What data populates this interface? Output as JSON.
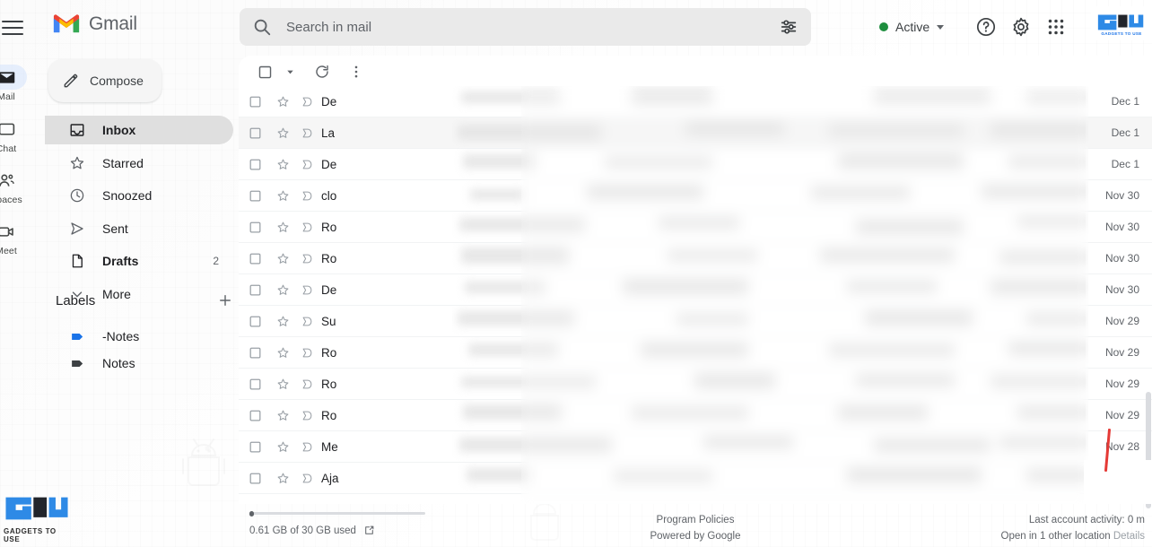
{
  "app": {
    "name": "Gmail",
    "brand_logo": "gmail-m-logo"
  },
  "rail": {
    "menu_icon": "hamburger-menu-icon",
    "items": [
      {
        "label": "Mail",
        "icon": "mail-icon",
        "active": true
      },
      {
        "label": "Chat",
        "icon": "chat-bubble-icon",
        "active": false
      },
      {
        "label": "Spaces",
        "icon": "spaces-people-icon",
        "active": false
      },
      {
        "label": "Meet",
        "icon": "meet-video-icon",
        "active": false
      }
    ]
  },
  "search": {
    "placeholder": "Search in mail",
    "value": "",
    "search_icon": "search-icon",
    "filter_icon": "filter-options-icon"
  },
  "header": {
    "status_label": "Active",
    "status_color": "#1e8e3e",
    "help_icon": "help-question-icon",
    "settings_icon": "gear-settings-icon",
    "apps_icon": "apps-grid-icon",
    "logo_text": "GADGETS TO USE",
    "logo_accent": "#1a73e8"
  },
  "sidebar": {
    "compose_label": "Compose",
    "compose_icon": "pencil-compose-icon",
    "nav": [
      {
        "label": "Inbox",
        "icon": "inbox-icon",
        "count": "",
        "active": true
      },
      {
        "label": "Starred",
        "icon": "star-icon",
        "count": "",
        "active": false
      },
      {
        "label": "Snoozed",
        "icon": "clock-snooze-icon",
        "count": "",
        "active": false
      },
      {
        "label": "Sent",
        "icon": "send-paperplane-icon",
        "count": "",
        "active": false
      },
      {
        "label": "Drafts",
        "icon": "draft-file-icon",
        "count": "2",
        "active": false
      },
      {
        "label": "More",
        "icon": "chevron-down-icon",
        "count": "",
        "active": false
      }
    ],
    "labels_title": "Labels",
    "labels_add_icon": "plus-add-label-icon",
    "labels": [
      {
        "label": "-Notes",
        "color": "#1a73e8"
      },
      {
        "label": "Notes",
        "color": "#3c4043"
      }
    ]
  },
  "toolbar": {
    "select_all_icon": "checkbox-select-all-icon",
    "select_caret_icon": "chevron-down-icon",
    "refresh_icon": "refresh-icon",
    "more_icon": "more-vertical-icon"
  },
  "mail_list": {
    "rows": [
      {
        "sender": "De",
        "date": "Dec 1",
        "shade": false
      },
      {
        "sender": "La",
        "date": "Dec 1",
        "shade": true
      },
      {
        "sender": "De",
        "date": "Dec 1",
        "shade": false
      },
      {
        "sender": "clo",
        "date": "Nov 30",
        "shade": false
      },
      {
        "sender": "Ro",
        "date": "Nov 30",
        "shade": false
      },
      {
        "sender": "Ro",
        "date": "Nov 30",
        "shade": false
      },
      {
        "sender": "De",
        "date": "Nov 30",
        "shade": false
      },
      {
        "sender": "Su",
        "date": "Nov 29",
        "shade": false
      },
      {
        "sender": "Ro",
        "date": "Nov 29",
        "shade": false
      },
      {
        "sender": "Ro",
        "date": "Nov 29",
        "shade": false
      },
      {
        "sender": "Ro",
        "date": "Nov 29",
        "shade": false
      },
      {
        "sender": "Me",
        "date": "Nov 28",
        "shade": false
      },
      {
        "sender": "Aja",
        "date": "",
        "shade": false
      }
    ],
    "row_checkbox_icon": "checkbox-icon",
    "row_star_icon": "star-outline-icon",
    "row_important_icon": "important-marker-icon"
  },
  "footer": {
    "storage_text": "0.61 GB of 30 GB used",
    "storage_open_icon": "open-external-icon",
    "program_policies": "Program Policies",
    "powered_by": "Powered by Google",
    "last_activity": "Last account activity: 0 m",
    "other_location": "Open in 1 other location",
    "details": "Details"
  },
  "watermark": {
    "text": "GADGETS TO USE",
    "accent": "#2e8ae6"
  }
}
